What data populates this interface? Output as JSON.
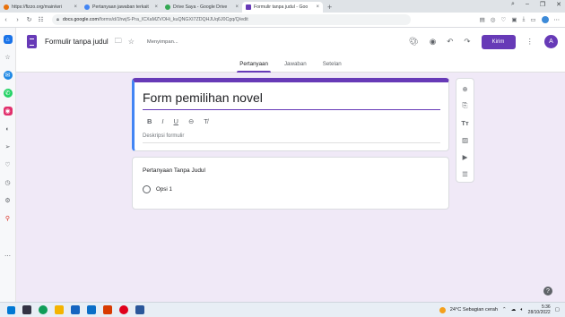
{
  "browser": {
    "tabs": [
      {
        "title": "https://fizzo.org/main/wri",
        "active": false
      },
      {
        "title": "Pertanyaan jawaban terkait",
        "active": false
      },
      {
        "title": "Drive Saya - Google Drive",
        "active": false
      },
      {
        "title": "Formulir tanpa judul - Goo",
        "active": true
      }
    ],
    "url_prefix": "docs.google.com",
    "url_rest": "/forms/d/1hwjS-Pra_ICXaMZVOHi_kuQNGXI7ZDQHJUq6J0Cgq/Q/edit"
  },
  "header": {
    "doc_title": "Formulir tanpa judul",
    "save_status": "Menyimpan...",
    "send_label": "Kirim",
    "avatar_letter": "A"
  },
  "tabs": [
    "Pertanyaan",
    "Jawaban",
    "Setelan"
  ],
  "form": {
    "title": "Form pemilihan novel",
    "description_placeholder": "Deskripsi formulir"
  },
  "question": {
    "title": "Pertanyaan Tanpa Judul",
    "option": "Opsi 1"
  },
  "taskbar": {
    "weather": "24°C  Sebagian cerah",
    "time": "5:36",
    "date": "28/10/2022"
  },
  "colors": {
    "accent": "#673ab7",
    "focus": "#4285f4"
  }
}
